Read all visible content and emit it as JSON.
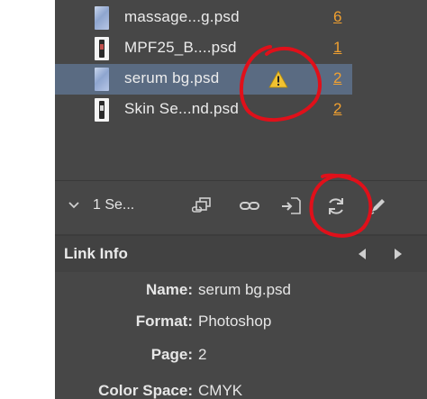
{
  "links": [
    {
      "name": "massage...g.psd",
      "count": "6",
      "thumb": "blue",
      "selected": false,
      "warning": false
    },
    {
      "name": "MPF25_B....psd",
      "count": "1",
      "thumb": "bottle-red",
      "selected": false,
      "warning": false
    },
    {
      "name": "serum bg.psd",
      "count": "2",
      "thumb": "blue",
      "selected": true,
      "warning": true
    },
    {
      "name": "Skin Se...nd.psd",
      "count": "2",
      "thumb": "bottle",
      "selected": false,
      "warning": false
    }
  ],
  "toolbar": {
    "selected_summary": "1 Se...",
    "icons": [
      "relink-from-cc-icon",
      "relink-icon",
      "go-to-link-icon",
      "update-link-icon",
      "edit-original-icon"
    ]
  },
  "link_info": {
    "title": "Link Info",
    "rows": [
      {
        "label": "Name:",
        "value": "serum bg.psd"
      },
      {
        "label": "Format:",
        "value": "Photoshop"
      },
      {
        "label": "Page:",
        "value": "2"
      },
      {
        "label": "Color Space:",
        "value": "CMYK"
      }
    ]
  },
  "colors": {
    "panel_bg": "#474747",
    "selected_row": "#5a6b82",
    "link_count": "#f0a030",
    "warning": "#f2c230",
    "annotation": "#e0101a"
  }
}
